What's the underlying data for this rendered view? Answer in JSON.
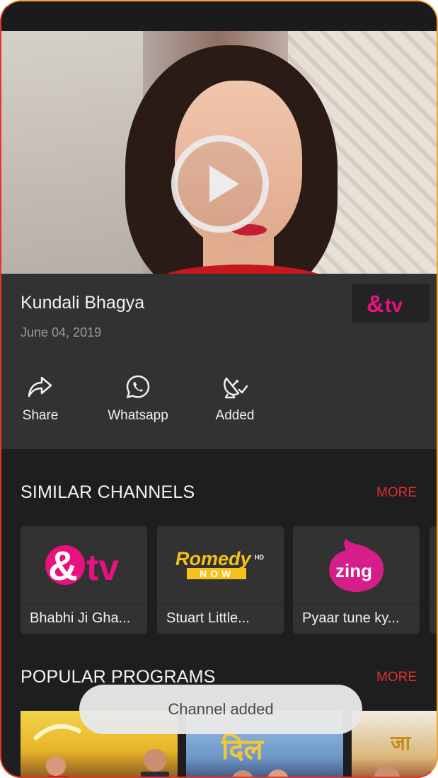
{
  "video": {
    "title": "Kundali Bhagya",
    "date": "June 04, 2019",
    "channel_logo": "&tv"
  },
  "actions": [
    {
      "label": "Share",
      "icon": "share-icon"
    },
    {
      "label": "Whatsapp",
      "icon": "whatsapp-icon"
    },
    {
      "label": "Added",
      "icon": "satellite-dish-check-icon"
    }
  ],
  "similar_channels": {
    "title": "SIMILAR CHANNELS",
    "more": "MORE",
    "items": [
      {
        "logo": "&tv",
        "name": "Bhabhi Ji Gha..."
      },
      {
        "logo": "Romedy NOW HD",
        "name": "Stuart Little..."
      },
      {
        "logo": "zing",
        "name": "Pyaar tune ky..."
      }
    ]
  },
  "popular_programs": {
    "title": "POPULAR PROGRAMS",
    "more": "MORE"
  },
  "toast": "Channel added",
  "colors": {
    "accent": "#e32d2d",
    "panel": "#323232",
    "background": "#1e1e1e"
  }
}
